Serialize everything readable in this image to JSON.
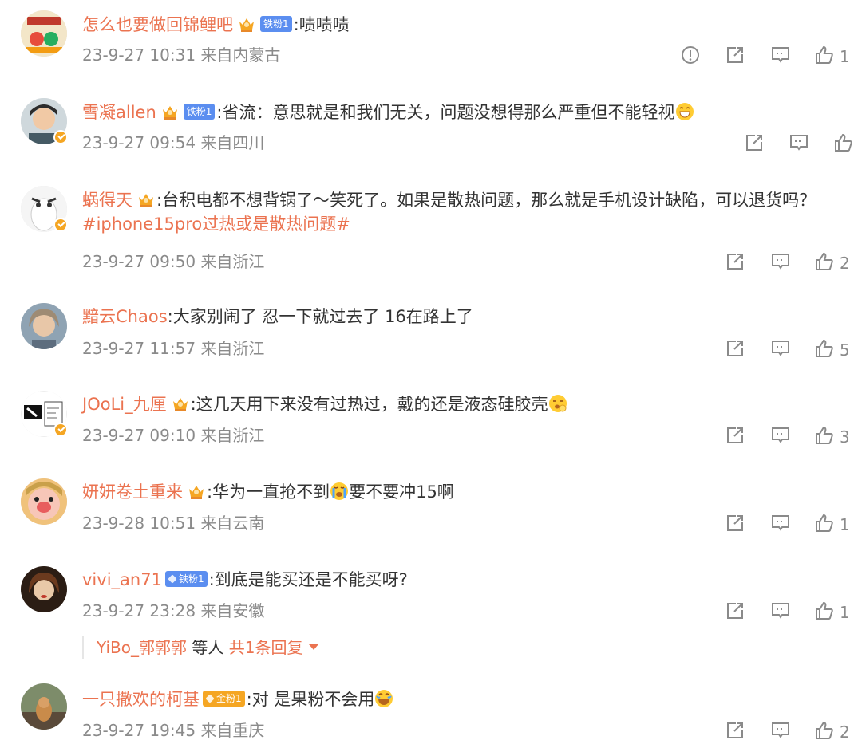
{
  "comments": [
    {
      "user": "怎么也要做回锦鲤吧",
      "badge": "铁粉1",
      "text": ":啧啧啧",
      "time": "23-9-27 10:31 来自内蒙古",
      "likes": "1"
    },
    {
      "user": "雪凝allen",
      "badge": "铁粉1",
      "text": ":省流：意思就是和我们无关，问题没想得那么严重但不能轻视",
      "time": "23-9-27 09:54 来自四川",
      "likes": ""
    },
    {
      "user": "蜗得天",
      "text1": ":台积电都不想背锅了～笑死了。如果是散热问题，那么就是手机设计缺陷，可以退货吗？",
      "topic": "#iphone15pro过热或是散热问题#",
      "time": "23-9-27 09:50 来自浙江",
      "likes": "2"
    },
    {
      "user": "黯云Chaos",
      "text": ":大家别闹了 忍一下就过去了 16在路上了",
      "time": "23-9-27 11:57 来自浙江",
      "likes": "5"
    },
    {
      "user": "JOoLi_九厘",
      "text": ":这几天用下来没有过热过，戴的还是液态硅胶壳",
      "time": "23-9-27 09:10 来自浙江",
      "likes": "3"
    },
    {
      "user": "妍妍卷土重来",
      "text1": ":华为一直抢不到",
      "text2": "要不要冲15啊",
      "time": "23-9-28 10:51 来自云南",
      "likes": "1"
    },
    {
      "user": "vivi_an71",
      "badge": "铁粉1",
      "text": ":到底是能买还是不能买呀?",
      "time": "23-9-27 23:28 来自安徽",
      "likes": "1"
    },
    {
      "user": "一只撒欢的柯基",
      "badge": "金粉1",
      "text": ":对 是果粉不会用",
      "time": "23-9-27 19:45 来自重庆",
      "likes": "2"
    }
  ],
  "reply": {
    "name": "YiBo_郭郭郭",
    "suffix": " 等人 ",
    "more": "共1条回复"
  },
  "colors": {
    "username": "#eb7350",
    "meta": "#8a8a8a",
    "iron_badge": "#5b8ef0",
    "gold_badge": "#f5a623"
  },
  "icons": {
    "report": "report-icon",
    "share": "share-icon",
    "comment": "comment-icon",
    "like": "thumbs-up-icon"
  }
}
